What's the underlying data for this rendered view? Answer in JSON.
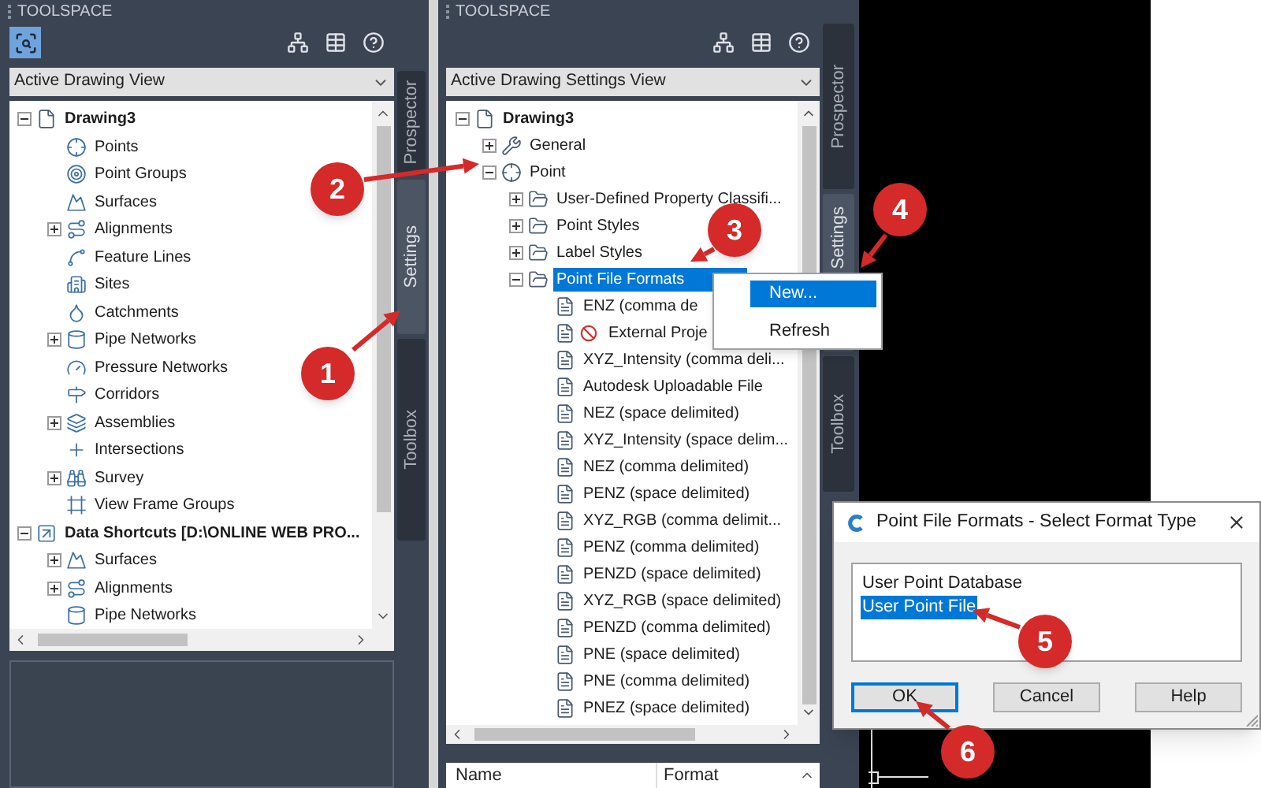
{
  "left_panel": {
    "title": "TOOLSPACE",
    "view": "Active Drawing View",
    "tabs": [
      {
        "label": "Prospector",
        "selected": false
      },
      {
        "label": "Settings",
        "selected": true
      },
      {
        "label": "Toolbox",
        "selected": false
      }
    ],
    "tree": [
      {
        "label": "Drawing3",
        "expanded": true,
        "selected": false,
        "children": [
          {
            "label": "Points",
            "selected": false
          },
          {
            "label": "Point Groups",
            "selected": false
          },
          {
            "label": "Surfaces",
            "selected": false
          },
          {
            "label": "Alignments",
            "expanded": false,
            "selected": false
          },
          {
            "label": "Feature Lines",
            "selected": false
          },
          {
            "label": "Sites",
            "selected": false
          },
          {
            "label": "Catchments",
            "selected": false
          },
          {
            "label": "Pipe Networks",
            "expanded": false,
            "selected": false
          },
          {
            "label": "Pressure Networks",
            "selected": false
          },
          {
            "label": "Corridors",
            "selected": false
          },
          {
            "label": "Assemblies",
            "expanded": false,
            "selected": false
          },
          {
            "label": "Intersections",
            "selected": false
          },
          {
            "label": "Survey",
            "expanded": false,
            "selected": false
          },
          {
            "label": "View Frame Groups",
            "selected": false
          }
        ]
      },
      {
        "label": "Data Shortcuts [D:\\ONLINE WEB PRO...",
        "expanded": true,
        "selected": false,
        "children": [
          {
            "label": "Surfaces",
            "expanded": false,
            "selected": false
          },
          {
            "label": "Alignments",
            "expanded": false,
            "selected": false
          },
          {
            "label": "Pipe Networks",
            "selected": false
          }
        ]
      }
    ]
  },
  "middle_panel": {
    "title": "TOOLSPACE",
    "view": "Active Drawing Settings View",
    "tabs": [
      {
        "label": "Prospector",
        "selected": false
      },
      {
        "label": "Settings",
        "selected": true
      },
      {
        "label": "Toolbox",
        "selected": false
      }
    ],
    "tree": [
      {
        "label": "Drawing3",
        "expanded": true,
        "selected": false,
        "children": [
          {
            "label": "General",
            "expanded": false,
            "selected": false
          },
          {
            "label": "Point",
            "expanded": true,
            "selected": false,
            "children": [
              {
                "label": "User-Defined Property Classifi...",
                "expanded": false,
                "selected": false
              },
              {
                "label": "Point Styles",
                "expanded": false,
                "selected": false
              },
              {
                "label": "Label Styles",
                "expanded": false,
                "selected": false
              },
              {
                "label": "Point File Formats",
                "expanded": true,
                "selected": true,
                "children": [
                  {
                    "label": "ENZ (comma de",
                    "selected": false,
                    "invalid": false
                  },
                  {
                    "label": "External Proje",
                    "selected": false,
                    "invalid": true
                  },
                  {
                    "label": "XYZ_Intensity (comma deli...",
                    "selected": false,
                    "invalid": false
                  },
                  {
                    "label": "Autodesk Uploadable File",
                    "selected": false,
                    "invalid": false
                  },
                  {
                    "label": "NEZ (space delimited)",
                    "selected": false,
                    "invalid": false
                  },
                  {
                    "label": "XYZ_Intensity (space delim...",
                    "selected": false,
                    "invalid": false
                  },
                  {
                    "label": "NEZ (comma delimited)",
                    "selected": false,
                    "invalid": false
                  },
                  {
                    "label": "PENZ (space delimited)",
                    "selected": false,
                    "invalid": false
                  },
                  {
                    "label": "XYZ_RGB (comma delimit...",
                    "selected": false,
                    "invalid": false
                  },
                  {
                    "label": "PENZ (comma delimited)",
                    "selected": false,
                    "invalid": false
                  },
                  {
                    "label": "PENZD (space delimited)",
                    "selected": false,
                    "invalid": false
                  },
                  {
                    "label": "XYZ_RGB (space delimited)",
                    "selected": false,
                    "invalid": false
                  },
                  {
                    "label": "PENZD (comma delimited)",
                    "selected": false,
                    "invalid": false
                  },
                  {
                    "label": "PNE (space delimited)",
                    "selected": false,
                    "invalid": false
                  },
                  {
                    "label": "PNE (comma delimited)",
                    "selected": false,
                    "invalid": false
                  },
                  {
                    "label": "PNEZ (space delimited)",
                    "selected": false,
                    "invalid": false
                  }
                ]
              }
            ]
          }
        ]
      }
    ],
    "list_columns": [
      "Name",
      "Format"
    ]
  },
  "context_menu": [
    {
      "label": "New...",
      "selected": true
    },
    {
      "label": "Refresh",
      "selected": false
    }
  ],
  "dialog": {
    "title": "Point File Formats - Select Format Type",
    "options": [
      {
        "label": "User Point Database",
        "selected": false
      },
      {
        "label": "User Point File",
        "selected": true
      }
    ],
    "buttons": [
      {
        "label": "OK",
        "focused": true
      },
      {
        "label": "Cancel",
        "focused": false
      },
      {
        "label": "Help",
        "focused": false
      }
    ]
  },
  "annotations": [
    "1",
    "2",
    "3",
    "4",
    "5",
    "6"
  ]
}
